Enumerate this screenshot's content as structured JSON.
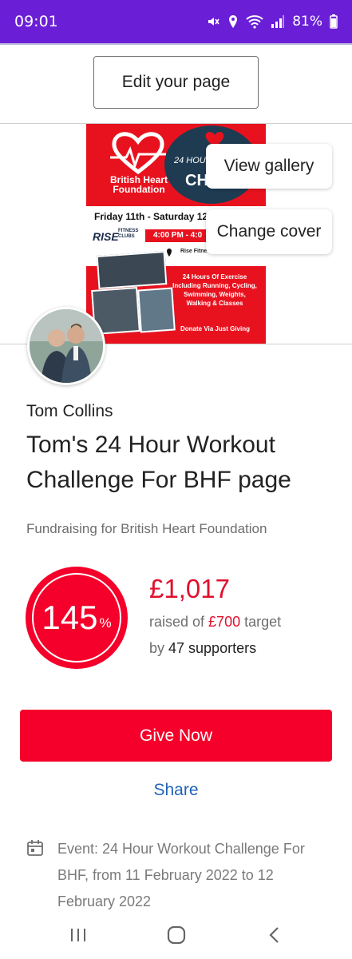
{
  "status_bar": {
    "time": "09:01",
    "battery": "81%"
  },
  "header": {
    "edit_label": "Edit your page"
  },
  "cover": {
    "menu": {
      "view_gallery": "View gallery",
      "change_cover": "Change cover"
    },
    "poster": {
      "charity_line1": "British Heart",
      "charity_line2": "Foundation",
      "badge_top": "24 HOU",
      "badge_big": "CHA",
      "dates": "Friday 11th - Saturday 12",
      "gym_logo": "RISE",
      "gym_logo_sub": "FITNESS CLUBS",
      "time": "4:00 PM - 4:0",
      "location": "Rise Fitness Telford",
      "copy": "24 Hours Of Exercise Including Running, Cycling, Swimming, Weights, Walking & Classes",
      "donate": "Donate Via Just Giving"
    }
  },
  "profile": {
    "owner": "Tom Collins",
    "title": "Tom's 24 Hour Workout Challenge For BHF page",
    "cause": "Fundraising for British Heart Foundation"
  },
  "progress": {
    "percent": "145",
    "percent_sign": "%",
    "raised": "£1,017",
    "raised_prefix": "raised of ",
    "target": "£700",
    "target_suffix": " target",
    "by_prefix": "by ",
    "supporters": "47 supporters"
  },
  "actions": {
    "give_label": "Give Now",
    "share_label": "Share"
  },
  "event": {
    "text": "Event: 24 Hour Workout Challenge For BHF, from 11 February 2022 to 12 February 2022"
  },
  "colors": {
    "status_bar": "#6a1fd6",
    "brand_red": "#f4002a",
    "link_blue": "#1f63b8"
  }
}
